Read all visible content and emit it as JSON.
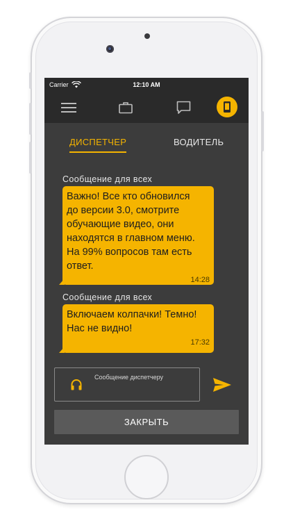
{
  "status_bar": {
    "carrier": "Carrier",
    "time": "12:10 AM"
  },
  "tabs": [
    {
      "label": "ДИСПЕТЧЕР",
      "active": true
    },
    {
      "label": "ВОДИТЕЛЬ",
      "active": false
    }
  ],
  "messages": [
    {
      "label": "Сообщение для всех",
      "text": "Важно! Все кто обновился\nдо версии 3.0, смотрите\nобучающие видео, они\nнаходятся в главном меню.\nНа 99% вопросов там есть\nответ.",
      "time": "14:28"
    },
    {
      "label": "Сообщение для всех",
      "text": "Включаем колпачки! Темно!\nНас не видно!",
      "time": "17:32"
    }
  ],
  "compose": {
    "placeholder": "Сообщение диспетчеру"
  },
  "close_label": "ЗАКРЫТЬ",
  "colors": {
    "accent": "#f5b400",
    "screen_bg": "#3c3c3c",
    "bar_bg": "#2a2a2a"
  }
}
